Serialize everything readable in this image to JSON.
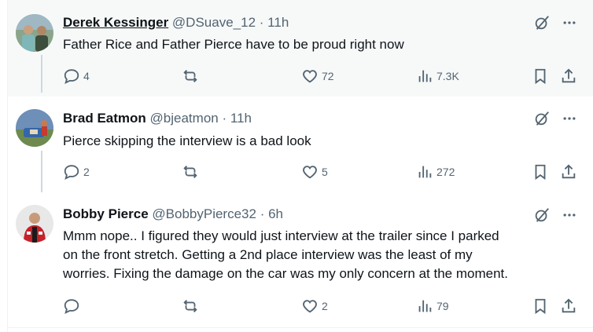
{
  "tweets": [
    {
      "name": "Derek Kessinger",
      "handle": "@DSuave_12",
      "dot": "·",
      "time": "11h",
      "text": "Father Rice and Father Pierce have to be proud right now",
      "replies": "4",
      "retweets": "",
      "likes": "72",
      "views": "7.3K"
    },
    {
      "name": "Brad Eatmon",
      "handle": "@bjeatmon",
      "dot": "·",
      "time": "11h",
      "text": "Pierce skipping the interview is a bad look",
      "replies": "2",
      "retweets": "",
      "likes": "5",
      "views": "272"
    },
    {
      "name": "Bobby Pierce",
      "handle": "@BobbyPierce32",
      "dot": "·",
      "time": "6h",
      "text_lines": [
        "Mmm nope.. I figured they would just interview at the trailer since I parked",
        "on the front stretch. Getting a 2nd place interview was the least of my",
        "worries. Fixing the damage on the car was my only concern at the moment."
      ],
      "replies": "",
      "retweets": "",
      "likes": "2",
      "views": "79"
    }
  ],
  "icons": {
    "grok": "grok-icon",
    "more": "more-icon",
    "reply": "reply-icon",
    "retweet": "retweet-icon",
    "like": "like-icon",
    "views": "views-icon",
    "bookmark": "bookmark-icon",
    "share": "share-icon"
  },
  "colors": {
    "text": "#0f1419",
    "secondary": "#536471",
    "hover_bg": "#f7f9f9",
    "thread_line": "#cfd9de"
  }
}
